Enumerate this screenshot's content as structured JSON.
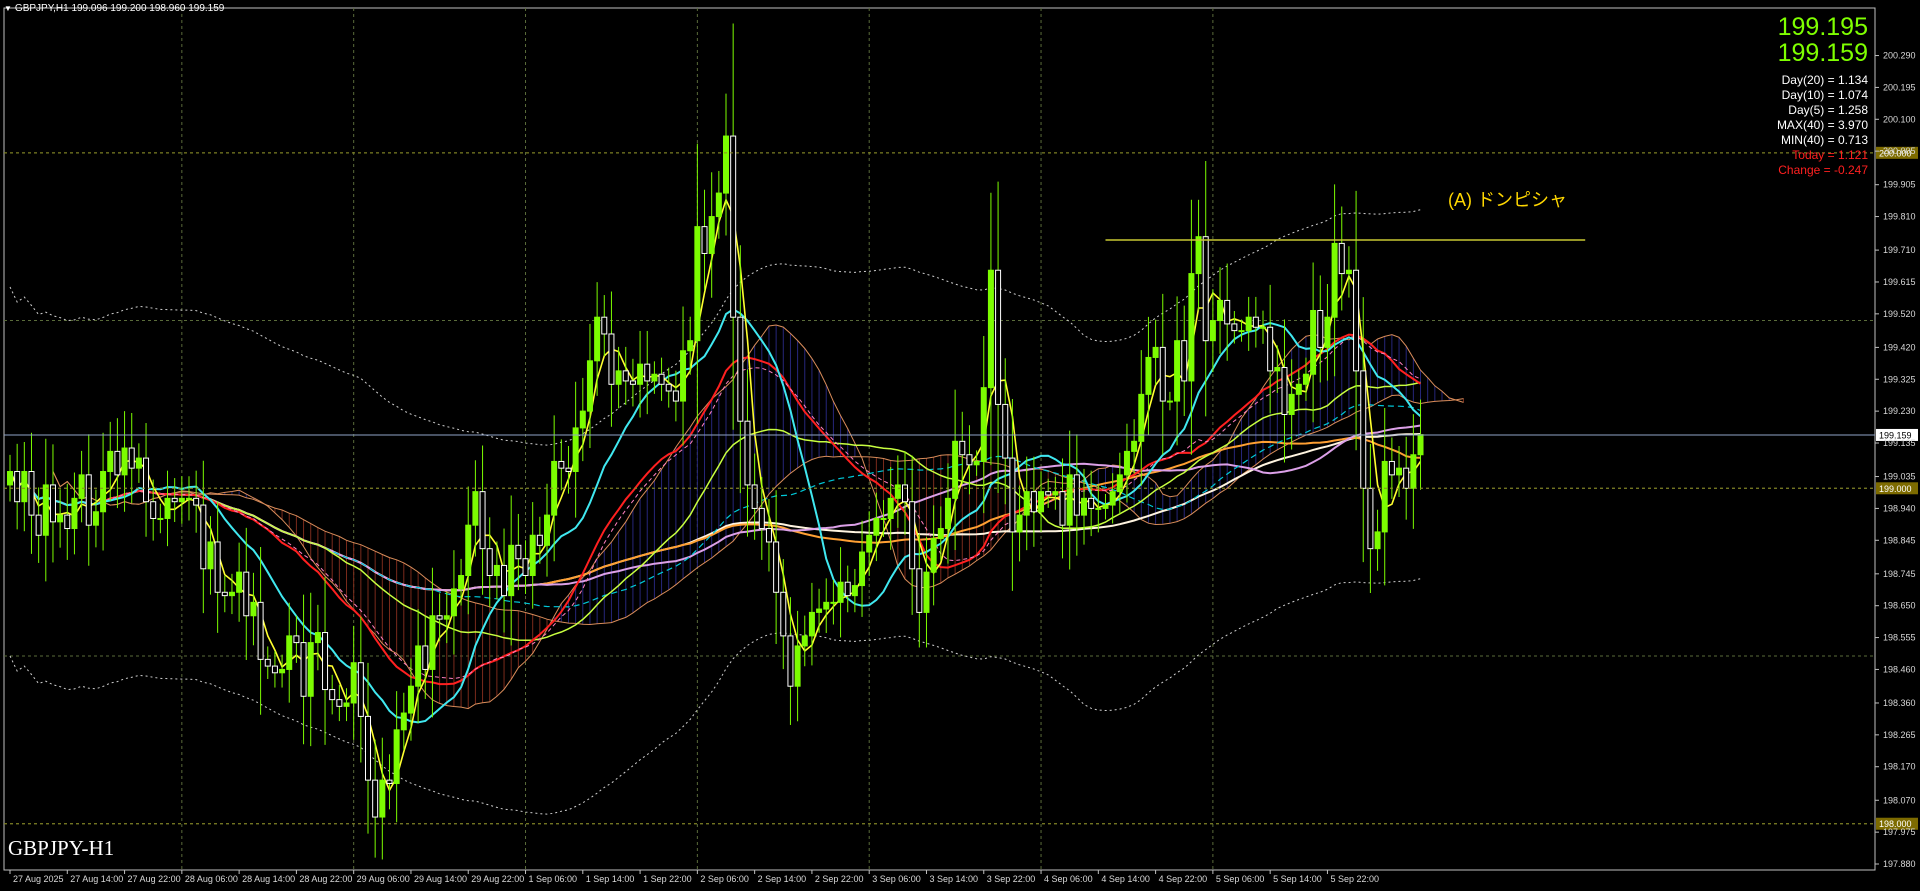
{
  "header": {
    "symbol": "GBPJPY,H1",
    "ohlc": "199.096 199.200 198.960 199.159"
  },
  "bid_price": "199.195",
  "ask_price": "199.159",
  "stats": [
    {
      "text": "Day(20) = 1.134",
      "color": "#ffffff"
    },
    {
      "text": "Day(10) = 1.074",
      "color": "#ffffff"
    },
    {
      "text": "Day(5) = 1.258",
      "color": "#ffffff"
    },
    {
      "text": "MAX(40) = 3.970",
      "color": "#ffffff"
    },
    {
      "text": "MIN(40) = 0.713",
      "color": "#ffffff"
    },
    {
      "text": "Today = 1.121",
      "color": "#ff2020"
    },
    {
      "text": "Change = -0.247",
      "color": "#ff2020"
    }
  ],
  "symbol_label": "GBPJPY-H1",
  "annotation": "(A) ドンピシャ",
  "colors": {
    "bull": "#7cfc00",
    "bear": "#ffffff",
    "grid": "#5a6b3a",
    "axis": "#c0c0c0",
    "price_line": "#8fa3c8",
    "level_box": "#7d6b00",
    "annotation": "#ffd700"
  },
  "chart_data": {
    "type": "candlestick",
    "symbol": "GBPJPY",
    "timeframe": "H1",
    "ylim": [
      197.88,
      200.39
    ],
    "y_ticks": [
      "200.290",
      "200.195",
      "200.100",
      "200.005",
      "199.905",
      "199.810",
      "199.710",
      "199.615",
      "199.520",
      "199.420",
      "199.325",
      "199.230",
      "199.135",
      "199.035",
      "198.940",
      "198.845",
      "198.745",
      "198.650",
      "198.555",
      "198.460",
      "198.360",
      "198.265",
      "198.170",
      "198.070",
      "197.975",
      "197.880"
    ],
    "x_ticks": [
      "27 Aug 2025",
      "27 Aug 14:00",
      "27 Aug 22:00",
      "28 Aug 06:00",
      "28 Aug 14:00",
      "28 Aug 22:00",
      "29 Aug 06:00",
      "29 Aug 14:00",
      "29 Aug 22:00",
      "1 Sep 06:00",
      "1 Sep 14:00",
      "1 Sep 22:00",
      "2 Sep 06:00",
      "2 Sep 14:00",
      "2 Sep 22:00",
      "3 Sep 06:00",
      "3 Sep 14:00",
      "3 Sep 22:00",
      "4 Sep 06:00",
      "4 Sep 14:00",
      "4 Sep 22:00",
      "5 Sep 06:00",
      "5 Sep 14:00",
      "5 Sep 22:00"
    ],
    "price_levels": [
      {
        "label": "199.159",
        "value": 199.159,
        "style": "current"
      },
      {
        "label": "200.000",
        "value": 200.0,
        "style": "level"
      },
      {
        "label": "199.000",
        "value": 199.0,
        "style": "level"
      },
      {
        "label": "198.000",
        "value": 198.0,
        "style": "level"
      }
    ],
    "resistance": {
      "value": 199.74,
      "from_index": 153,
      "to_index": 220
    },
    "closes": [
      199.05,
      198.96,
      199.05,
      198.92,
      198.86,
      199.01,
      198.9,
      198.92,
      198.88,
      198.97,
      199.04,
      198.89,
      198.93,
      199.05,
      199.11,
      199.04,
      199.12,
      199.06,
      199.09,
      198.96,
      198.91,
      198.91,
      198.97,
      198.96,
      198.97,
      198.97,
      198.95,
      198.76,
      198.84,
      198.69,
      198.68,
      198.69,
      198.75,
      198.62,
      198.66,
      198.49,
      198.47,
      198.45,
      198.46,
      198.56,
      198.54,
      198.38,
      198.54,
      198.57,
      198.4,
      198.37,
      198.35,
      198.36,
      198.48,
      198.32,
      198.13,
      198.02,
      198.13,
      198.12,
      198.28,
      198.33,
      198.41,
      198.53,
      198.46,
      198.62,
      198.61,
      198.62,
      198.7,
      198.74,
      198.89,
      198.99,
      198.82,
      198.74,
      198.77,
      198.68,
      198.83,
      198.79,
      198.74,
      198.86,
      198.83,
      198.92,
      199.08,
      199.06,
      199.05,
      199.18,
      199.23,
      199.38,
      199.51,
      199.46,
      199.31,
      199.35,
      199.32,
      199.31,
      199.37,
      199.32,
      199.34,
      199.31,
      199.29,
      199.26,
      199.41,
      199.44,
      199.78,
      199.7,
      199.81,
      199.88,
      200.05,
      199.51,
      199.2,
      199.01,
      198.94,
      198.88,
      198.84,
      198.69,
      198.56,
      198.41,
      198.53,
      198.56,
      198.63,
      198.64,
      198.66,
      198.66,
      198.72,
      198.68,
      198.71,
      198.81,
      198.86,
      198.91,
      198.91,
      198.97,
      199.01,
      198.96,
      198.76,
      198.63,
      198.75,
      198.85,
      198.88,
      198.97,
      199.14,
      199.1,
      199.07,
      199.08,
      199.3,
      199.65,
      199.25,
      199.09,
      198.87,
      198.92,
      198.99,
      198.93,
      198.99,
      198.98,
      198.99,
      198.89,
      199.04,
      198.92,
      198.97,
      198.94,
      198.94,
      198.95,
      198.99,
      199.04,
      199.11,
      199.14,
      199.28,
      199.39,
      199.42,
      199.26,
      199.26,
      199.44,
      199.32,
      199.64,
      199.75,
      199.44,
      199.5,
      199.56,
      199.49,
      199.47,
      199.47,
      199.51,
      199.48,
      199.48,
      199.35,
      199.36,
      199.22,
      199.28,
      199.31,
      199.34,
      199.53,
      199.42,
      199.51,
      199.73,
      199.64,
      199.65,
      199.35,
      199.0,
      198.82,
      198.87,
      199.08,
      199.04,
      199.06,
      199.0,
      199.1,
      199.16
    ],
    "indicators": [
      "moving averages (yellow, cyan, red, green-yellow, orange, violet, white)",
      "ichimoku cloud",
      "standard deviation bands"
    ]
  }
}
